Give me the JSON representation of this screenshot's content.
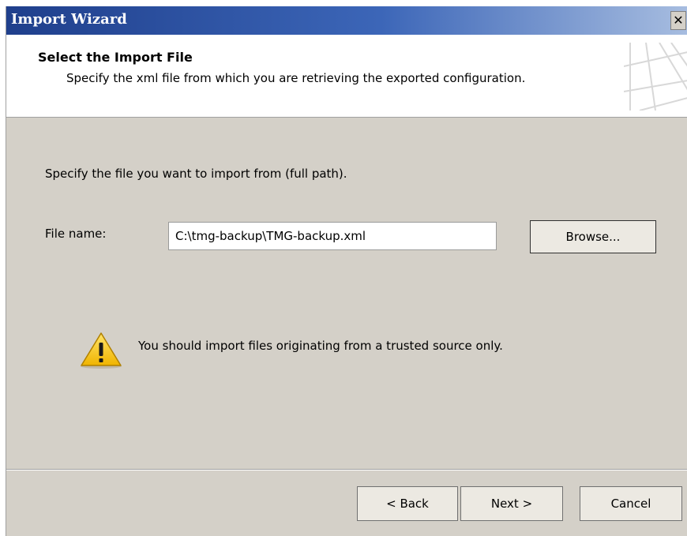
{
  "window": {
    "title": "Import Wizard",
    "close_glyph": "✕"
  },
  "header": {
    "title": "Select the Import File",
    "subtitle": "Specify the xml file from which you are retrieving the exported configuration."
  },
  "main": {
    "instruction": "Specify the file you want to import from (full path).",
    "file_label": "File name:",
    "file_value": "C:\\tmg-backup\\TMG-backup.xml",
    "browse_label": "Browse...",
    "warning_text": "You should import files originating from a trusted source only.",
    "warning_icon": "warning-icon"
  },
  "footer": {
    "back_label": "< Back",
    "next_label": "Next >",
    "cancel_label": "Cancel"
  },
  "colors": {
    "dialog_bg": "#d4d0c8",
    "titlebar_start": "#1f3f8c",
    "titlebar_end": "#a7bde0",
    "warning_yellow": "#f5c400"
  }
}
